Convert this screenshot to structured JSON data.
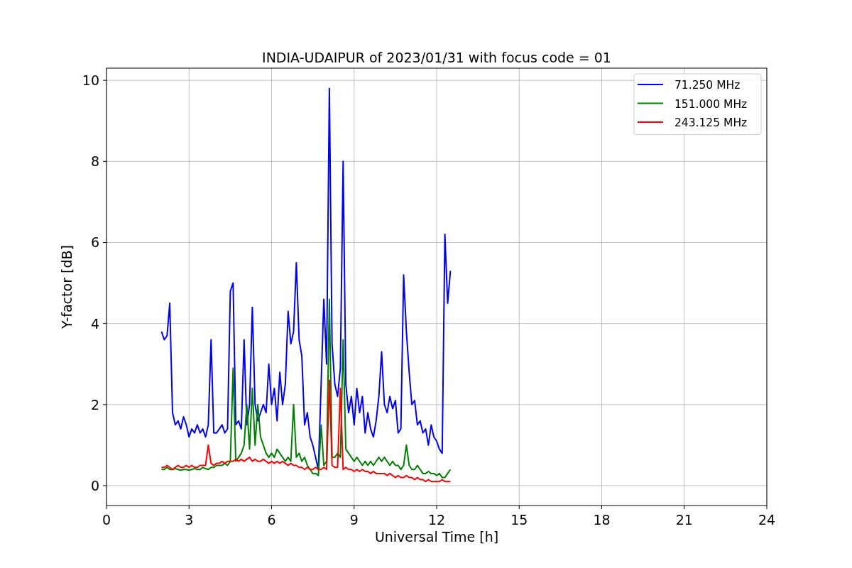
{
  "figure": {
    "chart_data": {
      "type": "line",
      "title": "INDIA-UDAIPUR of 2023/01/31 with focus code = 01",
      "xlabel": "Universal Time [h]",
      "ylabel": "Y-factor [dB]",
      "x": [
        2.0,
        2.1,
        2.2,
        2.3,
        2.4,
        2.5,
        2.6,
        2.7,
        2.8,
        2.9,
        3.0,
        3.1,
        3.2,
        3.3,
        3.4,
        3.5,
        3.6,
        3.7,
        3.8,
        3.9,
        4.0,
        4.1,
        4.2,
        4.3,
        4.4,
        4.5,
        4.6,
        4.7,
        4.8,
        4.9,
        5.0,
        5.1,
        5.2,
        5.3,
        5.4,
        5.5,
        5.6,
        5.7,
        5.8,
        5.9,
        6.0,
        6.1,
        6.2,
        6.3,
        6.4,
        6.5,
        6.6,
        6.7,
        6.8,
        6.9,
        7.0,
        7.1,
        7.2,
        7.3,
        7.4,
        7.5,
        7.6,
        7.7,
        7.8,
        7.9,
        8.0,
        8.1,
        8.2,
        8.3,
        8.4,
        8.5,
        8.6,
        8.7,
        8.8,
        8.9,
        9.0,
        9.1,
        9.2,
        9.3,
        9.4,
        9.5,
        9.6,
        9.7,
        9.8,
        9.9,
        10.0,
        10.1,
        10.2,
        10.3,
        10.4,
        10.5,
        10.6,
        10.7,
        10.8,
        10.9,
        11.0,
        11.1,
        11.2,
        11.3,
        11.4,
        11.5,
        11.6,
        11.7,
        11.8,
        11.9,
        12.0,
        12.1,
        12.2,
        12.3,
        12.4,
        12.5
      ],
      "series": [
        {
          "name": "71.250 MHz",
          "color": "#0000ff",
          "values": [
            3.8,
            3.6,
            3.7,
            4.5,
            1.8,
            1.5,
            1.6,
            1.4,
            1.7,
            1.5,
            1.2,
            1.4,
            1.3,
            1.5,
            1.3,
            1.4,
            1.2,
            1.5,
            3.6,
            1.3,
            1.3,
            1.4,
            1.5,
            1.3,
            1.4,
            4.8,
            5.0,
            1.5,
            1.6,
            1.4,
            3.6,
            1.5,
            2.0,
            4.4,
            2.0,
            1.6,
            1.8,
            2.0,
            1.8,
            3.0,
            2.0,
            2.4,
            1.6,
            2.8,
            2.0,
            2.5,
            4.3,
            3.5,
            3.8,
            5.5,
            3.6,
            3.2,
            1.5,
            1.8,
            1.2,
            1.0,
            0.7,
            0.4,
            2.5,
            4.6,
            3.0,
            9.8,
            3.5,
            2.5,
            2.2,
            2.9,
            8.0,
            2.5,
            1.8,
            2.2,
            1.5,
            2.4,
            1.8,
            2.2,
            1.3,
            1.8,
            1.4,
            1.2,
            1.6,
            2.2,
            3.3,
            2.0,
            1.8,
            2.2,
            1.9,
            2.1,
            1.3,
            1.4,
            5.2,
            3.8,
            2.8,
            2.0,
            2.1,
            1.5,
            1.6,
            1.3,
            1.4,
            1.0,
            1.5,
            1.2,
            1.1,
            0.9,
            0.8,
            6.2,
            4.5,
            5.3
          ]
        },
        {
          "name": "151.000 MHz",
          "color": "#008000",
          "values": [
            0.4,
            0.4,
            0.45,
            0.4,
            0.4,
            0.42,
            0.4,
            0.38,
            0.4,
            0.4,
            0.38,
            0.4,
            0.42,
            0.4,
            0.4,
            0.45,
            0.42,
            0.4,
            0.45,
            0.45,
            0.5,
            0.5,
            0.5,
            0.55,
            0.5,
            0.6,
            2.9,
            0.6,
            0.7,
            0.8,
            1.0,
            2.0,
            0.9,
            2.4,
            1.0,
            2.0,
            1.2,
            1.0,
            0.8,
            0.7,
            0.8,
            0.7,
            0.9,
            0.8,
            0.7,
            0.6,
            0.7,
            0.6,
            2.0,
            0.7,
            0.8,
            0.6,
            0.7,
            0.5,
            0.4,
            0.3,
            0.3,
            0.25,
            1.5,
            0.5,
            0.6,
            4.6,
            0.7,
            0.7,
            0.8,
            0.7,
            3.6,
            0.9,
            0.8,
            0.7,
            0.6,
            0.7,
            0.6,
            0.5,
            0.6,
            0.5,
            0.6,
            0.5,
            0.6,
            0.7,
            0.6,
            0.7,
            0.6,
            0.5,
            0.6,
            0.5,
            0.5,
            0.4,
            0.5,
            1.0,
            0.5,
            0.4,
            0.4,
            0.5,
            0.4,
            0.3,
            0.3,
            0.35,
            0.3,
            0.3,
            0.25,
            0.3,
            0.2,
            0.2,
            0.3,
            0.4
          ]
        },
        {
          "name": "243.125 MHz",
          "color": "#ff0000",
          "values": [
            0.45,
            0.45,
            0.5,
            0.45,
            0.4,
            0.45,
            0.5,
            0.45,
            0.45,
            0.5,
            0.45,
            0.5,
            0.45,
            0.45,
            0.5,
            0.5,
            0.5,
            1.0,
            0.55,
            0.5,
            0.55,
            0.55,
            0.6,
            0.55,
            0.6,
            0.6,
            0.6,
            0.65,
            0.6,
            0.65,
            0.6,
            0.65,
            0.7,
            0.6,
            0.65,
            0.6,
            0.6,
            0.65,
            0.6,
            0.55,
            0.6,
            0.55,
            0.6,
            0.55,
            0.6,
            0.55,
            0.5,
            0.55,
            0.5,
            0.5,
            0.45,
            0.45,
            0.4,
            0.45,
            0.4,
            0.4,
            0.45,
            0.4,
            0.4,
            0.45,
            0.4,
            2.6,
            0.5,
            0.45,
            0.45,
            2.4,
            0.4,
            0.45,
            0.4,
            0.4,
            0.35,
            0.4,
            0.35,
            0.4,
            0.35,
            0.35,
            0.3,
            0.35,
            0.3,
            0.3,
            0.3,
            0.3,
            0.25,
            0.3,
            0.25,
            0.2,
            0.25,
            0.2,
            0.2,
            0.25,
            0.2,
            0.2,
            0.15,
            0.2,
            0.15,
            0.15,
            0.1,
            0.15,
            0.1,
            0.1,
            0.1,
            0.1,
            0.15,
            0.1,
            0.1,
            0.1
          ]
        }
      ],
      "grid": true,
      "legend": "upper right",
      "xlim": [
        0,
        24
      ],
      "ylim": [
        -0.49,
        10.3
      ],
      "xticks": [
        0,
        3,
        6,
        9,
        12,
        15,
        18,
        21,
        24
      ],
      "yticks": [
        0,
        2,
        4,
        6,
        8,
        10
      ]
    }
  }
}
